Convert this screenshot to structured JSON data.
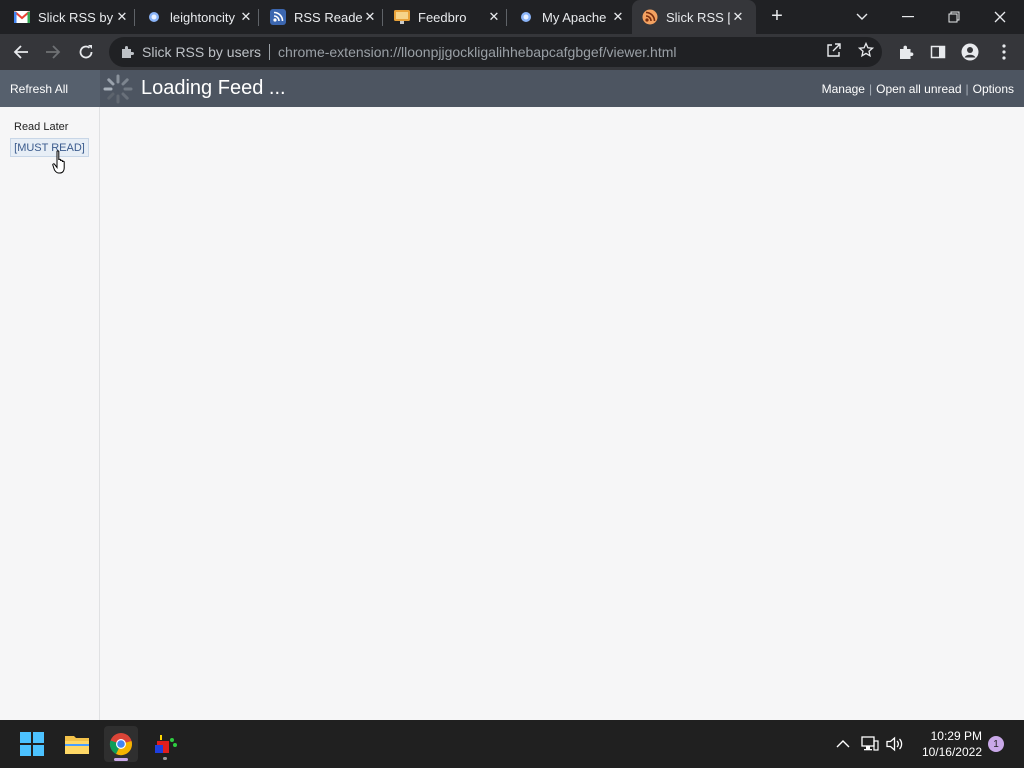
{
  "browser": {
    "tabs": [
      {
        "title": "Slick RSS by",
        "icon": "gmail-icon",
        "active": false
      },
      {
        "title": "leightoncity",
        "icon": "globe-icon",
        "active": false
      },
      {
        "title": "RSS Reader",
        "icon": "rss-reader-icon",
        "active": false
      },
      {
        "title": "Feedbro",
        "icon": "feedbro-icon",
        "active": false
      },
      {
        "title": "My Apache",
        "icon": "globe-icon",
        "active": false
      },
      {
        "title": "Slick RSS [[",
        "icon": "slick-rss-icon",
        "active": true
      }
    ],
    "site_name": "Slick RSS by users",
    "url": "chrome-extension://lloonpjjgockligalihhebapcafgbgef/viewer.html"
  },
  "app": {
    "refresh_all": "Refresh All",
    "feed_title": "Loading Feed ...",
    "links": {
      "manage": "Manage",
      "open_all_unread": "Open all unread",
      "options": "Options",
      "separator": "|"
    },
    "sidebar": {
      "heading": "Read Later",
      "items": [
        {
          "label": "[MUST READ]"
        }
      ]
    }
  },
  "taskbar": {
    "time": "10:29 PM",
    "date": "10/16/2022",
    "notification_count": "1"
  },
  "colors": {
    "header": "#4d5561",
    "page_bg": "#f6f6f7",
    "link": "#3b5b8d",
    "tab_strip": "#202124",
    "taskbar": "#202020"
  }
}
